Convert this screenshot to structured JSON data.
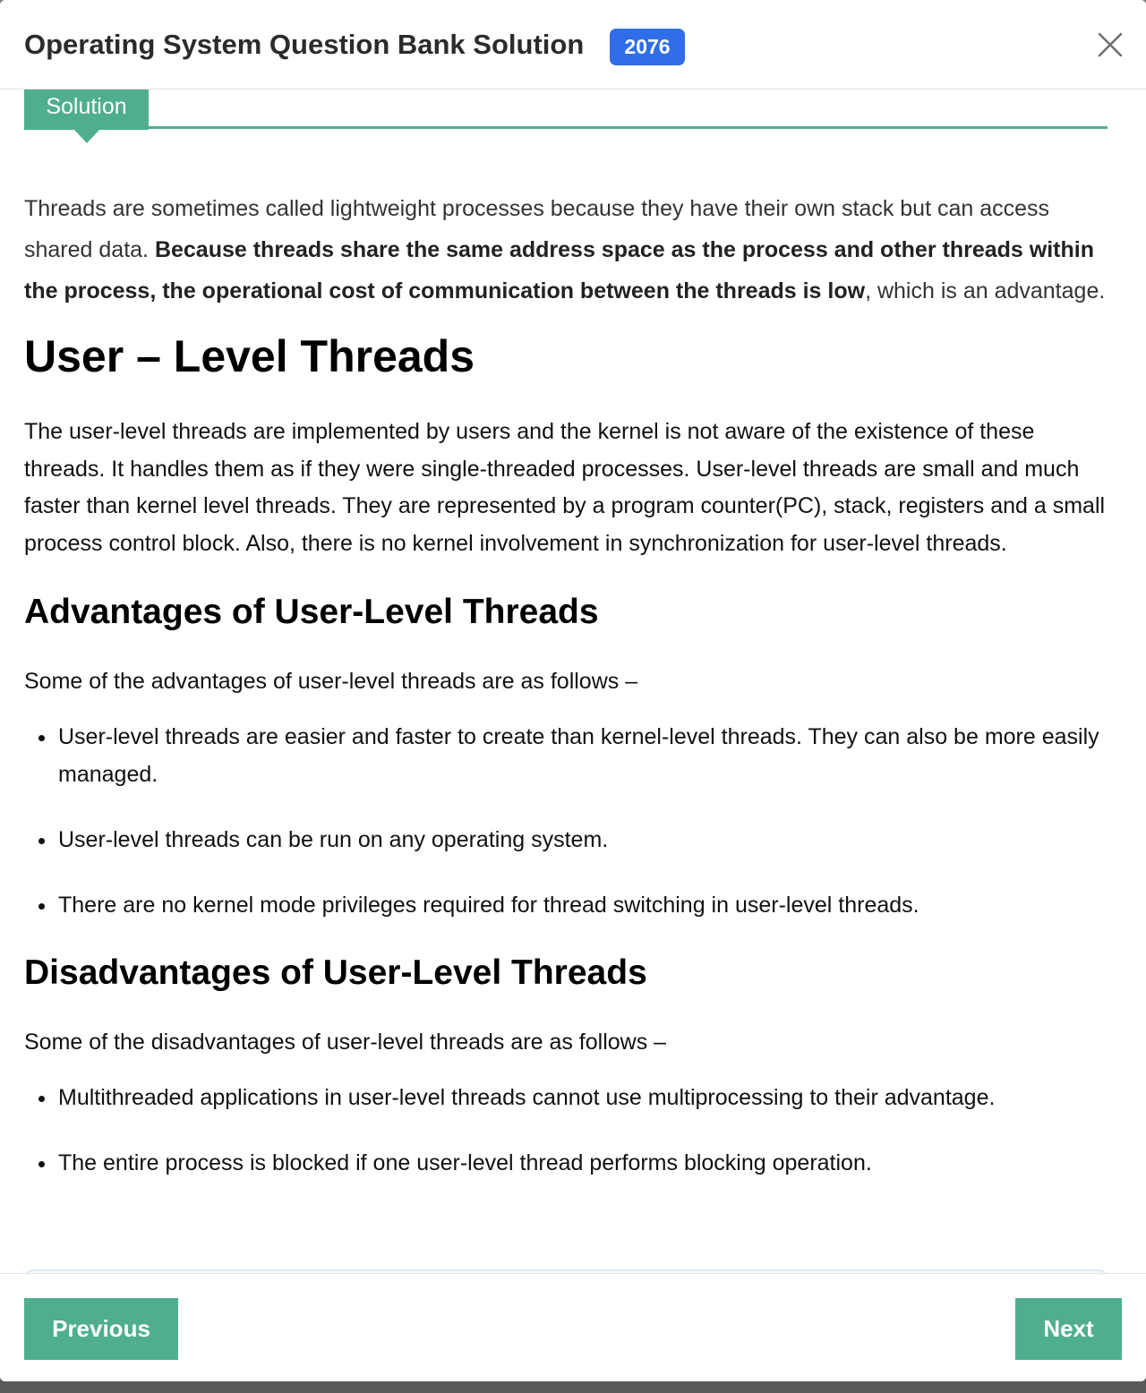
{
  "modal": {
    "title": "Operating System Question Bank Solution",
    "badge": "2076"
  },
  "icons": {
    "close": "close-icon"
  },
  "colors": {
    "accent_green": "#4fae90",
    "badge_blue": "#2f6ee8"
  },
  "solution_tab": {
    "label": "Solution"
  },
  "content": {
    "intro_part1": "Threads are sometimes called lightweight processes because they have their own stack but can access shared data. ",
    "intro_bold": "Because threads share the same address space as the process and other threads within the process, the operational cost of communication between the threads is low",
    "intro_part2": ", which is an advantage.",
    "heading_user_level": "User – Level Threads",
    "user_level_para": "The user-level threads are implemented by users and the kernel is not aware of the existence of these threads. It handles them as if they were single-threaded processes. User-level threads are small and much faster than kernel level threads. They are represented by a program counter(PC), stack, registers and a small process control block. Also, there is no kernel involvement in synchronization for user-level threads.",
    "heading_advantages": "Advantages of User-Level Threads",
    "advantages_lead": "Some of the advantages of user-level threads are as follows –",
    "advantages": [
      "User-level threads are easier and faster to create than kernel-level threads. They can also be more easily managed.",
      "User-level threads can be run on any operating system.",
      "There are no kernel mode privileges required for thread switching in user-level threads."
    ],
    "heading_disadvantages": "Disadvantages of User-Level Threads",
    "disadvantages_lead": "Some of the disadvantages of user-level threads are as follows –",
    "disadvantages": [
      "Multithreaded applications in user-level threads cannot use multiprocessing to their advantage.",
      "The entire process is blocked if one user-level thread performs blocking operation."
    ]
  },
  "footer": {
    "previous_label": "Previous",
    "next_label": "Next"
  }
}
